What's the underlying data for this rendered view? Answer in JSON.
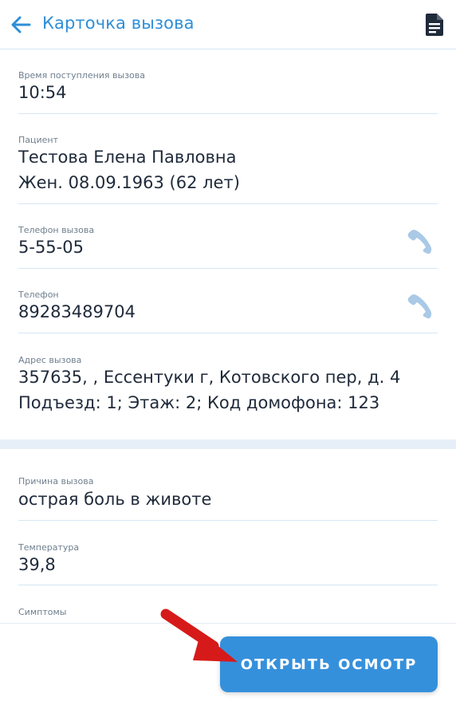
{
  "header": {
    "title": "Карточка вызова",
    "back_icon": "arrow-left-icon",
    "doc_icon": "document-icon"
  },
  "fields": {
    "time": {
      "label": "Время поступления вызова",
      "value": "10:54"
    },
    "patient": {
      "label": "Пациент",
      "line1": "Тестова Елена Павловна",
      "line2": "Жен. 08.09.1963 (62 лет)"
    },
    "call_phone": {
      "label": "Телефон вызова",
      "value": "5-55-05"
    },
    "phone": {
      "label": "Телефон",
      "value": "89283489704"
    },
    "address": {
      "label": "Адрес вызова",
      "line1": "357635, , Ессентуки г, Котовского пер, д. 4",
      "line2": "Подъезд: 1; Этаж: 2; Код домофона: 123"
    },
    "reason": {
      "label": "Причина вызова",
      "value": "острая боль в животе"
    },
    "temperature": {
      "label": "Температура",
      "value": "39,8"
    },
    "symptoms": {
      "label": "Симптомы",
      "value": ""
    }
  },
  "actions": {
    "open_exam": "ОТКРЫТЬ ОСМОТР"
  },
  "colors": {
    "accent": "#2d8fd8",
    "button": "#3590dc",
    "phone_icon": "#a9c9e6",
    "arrow": "#d61a1a",
    "divider": "#d7e6f3"
  }
}
